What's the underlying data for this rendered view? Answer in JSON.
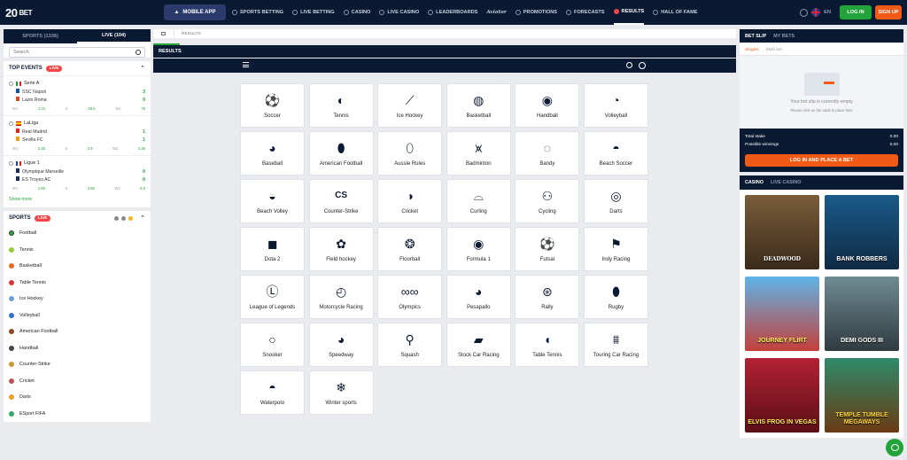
{
  "brand": {
    "logo_text": "20",
    "logo_suffix": "BET"
  },
  "topnav": {
    "mobile_app": "MOBILE APP",
    "items": [
      "SPORTS BETTING",
      "LIVE BETTING",
      "CASINO",
      "LIVE CASINO",
      "LEADERBOARDS",
      "Aviator",
      "PROMOTIONS",
      "FORECASTS",
      "RESULTS",
      "HALL OF FAME"
    ],
    "active": "RESULTS",
    "language": "EN",
    "login": "LOG IN",
    "signup": "SIGN UP"
  },
  "left": {
    "tabs": [
      "SPORTS (1336)",
      "LIVE (104)"
    ],
    "search_placeholder": "Search",
    "top_events_title": "TOP EVENTS",
    "live_badge": "LIVE",
    "events": [
      {
        "league": "Serie A",
        "home": "SSC Napoli",
        "away": "Lazio Roma",
        "home_score": "3",
        "away_score": "0",
        "odds": [
          "W1",
          "1.01",
          "X",
          "18.5",
          "W2",
          "75"
        ]
      },
      {
        "league": "LaLiga",
        "home": "Real Madrid",
        "away": "Sevilla FC",
        "home_score": "1",
        "away_score": "1",
        "odds": [
          "W1",
          "2.35",
          "X",
          "2.9",
          "W2",
          "4.35"
        ]
      },
      {
        "league": "Ligue 1",
        "home": "Olympique Marseille",
        "away": "ES Troyes AC",
        "home_score": "0",
        "away_score": "0",
        "odds": [
          "W1",
          "1.65",
          "X",
          "3.65",
          "W2",
          "5.9"
        ]
      }
    ],
    "show_more": "Show more",
    "sports_title": "SPORTS",
    "sports": [
      "Football",
      "Tennis",
      "Basketball",
      "Table Tennis",
      "Ice Hockey",
      "Volleyball",
      "American Football",
      "Handball",
      "Counter-Strike",
      "Cricket",
      "Darts",
      "ESport FIFA"
    ]
  },
  "center": {
    "breadcrumb": "RESULTS",
    "title": "RESULTS",
    "sports": [
      {
        "label": "Soccer",
        "icon": "soccer-icon",
        "glyph": "⚽"
      },
      {
        "label": "Tennis",
        "icon": "tennis-icon",
        "glyph": "◐"
      },
      {
        "label": "Ice Hockey",
        "icon": "ice-hockey-icon",
        "glyph": "⟋"
      },
      {
        "label": "Basketball",
        "icon": "basketball-icon",
        "glyph": "◍"
      },
      {
        "label": "Handball",
        "icon": "handball-icon",
        "glyph": "◉"
      },
      {
        "label": "Volleyball",
        "icon": "volleyball-icon",
        "glyph": "◔"
      },
      {
        "label": "Baseball",
        "icon": "baseball-icon",
        "glyph": "◕"
      },
      {
        "label": "American Football",
        "icon": "american-football-icon",
        "glyph": "⬮"
      },
      {
        "label": "Aussie Rules",
        "icon": "aussie-rules-icon",
        "glyph": "⬯"
      },
      {
        "label": "Badminton",
        "icon": "badminton-icon",
        "glyph": "⩙"
      },
      {
        "label": "Bandy",
        "icon": "bandy-icon",
        "glyph": "◌"
      },
      {
        "label": "Beach Soccer",
        "icon": "beach-soccer-icon",
        "glyph": "◓"
      },
      {
        "label": "Beach Volley",
        "icon": "beach-volley-icon",
        "glyph": "◒"
      },
      {
        "label": "Counter-Strike",
        "icon": "counter-strike-icon",
        "glyph": "CS"
      },
      {
        "label": "Cricket",
        "icon": "cricket-icon",
        "glyph": "◑"
      },
      {
        "label": "Curling",
        "icon": "curling-icon",
        "glyph": "⌓"
      },
      {
        "label": "Cycling",
        "icon": "cycling-icon",
        "glyph": "⚇"
      },
      {
        "label": "Darts",
        "icon": "darts-icon",
        "glyph": "◎"
      },
      {
        "label": "Dota 2",
        "icon": "dota-2-icon",
        "glyph": "◼"
      },
      {
        "label": "Field hockey",
        "icon": "field-hockey-icon",
        "glyph": "✿"
      },
      {
        "label": "Floorball",
        "icon": "floorball-icon",
        "glyph": "❂"
      },
      {
        "label": "Formula 1",
        "icon": "formula-1-icon",
        "glyph": "◉"
      },
      {
        "label": "Futsal",
        "icon": "futsal-icon",
        "glyph": "⚽"
      },
      {
        "label": "Indy Racing",
        "icon": "indy-racing-icon",
        "glyph": "⚑"
      },
      {
        "label": "League of Legends",
        "icon": "league-of-legends-icon",
        "glyph": "Ⓛ"
      },
      {
        "label": "Motorcycle Racing",
        "icon": "motorcycle-racing-icon",
        "glyph": "◴"
      },
      {
        "label": "Olympics",
        "icon": "olympics-icon",
        "glyph": "∞∞"
      },
      {
        "label": "Pesapallo",
        "icon": "pesapallo-icon",
        "glyph": "◕"
      },
      {
        "label": "Rally",
        "icon": "rally-icon",
        "glyph": "⊛"
      },
      {
        "label": "Rugby",
        "icon": "rugby-icon",
        "glyph": "⬮"
      },
      {
        "label": "Snooker",
        "icon": "snooker-icon",
        "glyph": "○"
      },
      {
        "label": "Speedway",
        "icon": "speedway-icon",
        "glyph": "◕"
      },
      {
        "label": "Squash",
        "icon": "squash-icon",
        "glyph": "⚲"
      },
      {
        "label": "Stock Car Racing",
        "icon": "stock-car-racing-icon",
        "glyph": "▰"
      },
      {
        "label": "Table Tennis",
        "icon": "table-tennis-icon",
        "glyph": "◖"
      },
      {
        "label": "Touring Car Racing",
        "icon": "touring-car-racing-icon",
        "glyph": "⩩"
      },
      {
        "label": "Waterpolo",
        "icon": "waterpolo-icon",
        "glyph": "◓"
      },
      {
        "label": "Winter sports",
        "icon": "winter-sports-icon",
        "glyph": "❄"
      }
    ]
  },
  "right": {
    "betslip_tab": "BET SLIP",
    "mybets_tab": "MY BETS",
    "singles": "Singles",
    "multibet": "Multi bet",
    "empty_title": "Your bet slip is currently empty",
    "empty_hint": "Please click on the odds to place bets",
    "total_stake_label": "Total stake",
    "total_stake_value": "0.00",
    "possible_label": "Possible winnings",
    "possible_value": "0.00",
    "cta": "LOG IN AND PLACE A BET",
    "casino_tab": "CASINO",
    "live_casino_tab": "LIVE CASINO",
    "games": [
      "DEADWOOD",
      "BANK ROBBERS",
      "JOURNEY FLIRT",
      "DEMI GODS III",
      "ELVIS FROG IN VEGAS",
      "TEMPLE TUMBLE MEGAWAYS"
    ]
  },
  "colors": {
    "navy": "#0b1a33",
    "green": "#22a43a",
    "orange": "#f05a16",
    "red": "#f24646"
  }
}
